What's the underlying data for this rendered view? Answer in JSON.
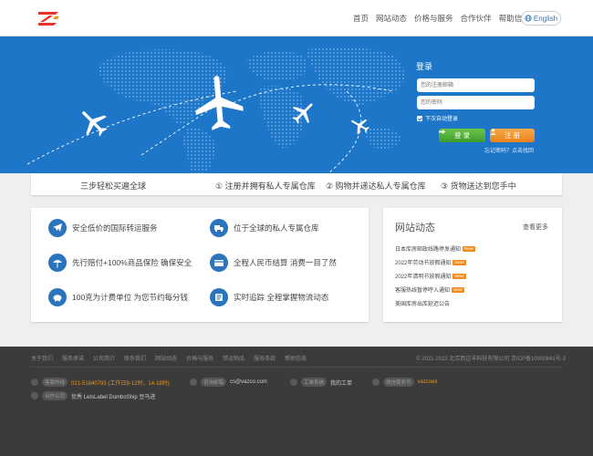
{
  "nav": {
    "items": [
      "首页",
      "网站动态",
      "价格与服务",
      "合作伙伴",
      "帮助信息"
    ],
    "lang_label": "English"
  },
  "login": {
    "title": "登录",
    "username_placeholder": "您的注册邮箱",
    "password_placeholder": "您的密码",
    "remember_label": "下次自动登录",
    "login_button": "登 录",
    "register_button": "注 册",
    "forgot_text": "忘记密码？点击找回"
  },
  "steps": {
    "title": "三步轻松买遍全球",
    "items": [
      "① 注册并拥有私人专属仓库",
      "② 购物并递达私人专属仓库",
      "③ 货物送达到您手中"
    ]
  },
  "features": [
    {
      "icon": "plane-icon",
      "text": "安全低价的国际转运服务"
    },
    {
      "icon": "truck-icon",
      "text": "位于全球的私人专属仓库"
    },
    {
      "icon": "umbrella-icon",
      "text": "先行赔付+100%商品保险 确保安全"
    },
    {
      "icon": "card-icon",
      "text": "全程人民币结算 消费一目了然"
    },
    {
      "icon": "piggy-bank-icon",
      "text": "100克为计费单位 为您节约每分钱"
    },
    {
      "icon": "list-icon",
      "text": "实时追踪 全程掌握物流动态"
    }
  ],
  "news": {
    "title": "网站动态",
    "more": "查看更多",
    "items": [
      {
        "text": "日本库房邮政线路停发通知",
        "is_new": true
      },
      {
        "text": "2022年劳动节放假通知",
        "is_new": true
      },
      {
        "text": "2022年清明节放假通知",
        "is_new": true
      },
      {
        "text": "客服热线暂停呼入通知",
        "is_new": true
      },
      {
        "text": "美国库房出库延迟公告",
        "is_new": false
      }
    ],
    "new_tag": "New!"
  },
  "footer": {
    "links": [
      "关于我们",
      "服务承诺",
      "公司简介",
      "联系我们",
      "网站动态",
      "价格与服务",
      "禁运物品",
      "服务条款",
      "帮助信息"
    ],
    "copyright": "© 2011-2022 北京西边羊科技有限公司 京ICP备10000841号-3",
    "phone_label": "客服热线",
    "phone_value": "021-51840793 (工作日9-12时，14-18时)",
    "email_label": "咨询邮箱",
    "email_value": "cs@vazco.com",
    "work_label": "工单系统",
    "work_value": "我的工单",
    "wechat_label": "微信服务号",
    "wechat_value": "vazcoex",
    "partner_label": "合作公司",
    "partners": "优秀  LetsLabel  DumboShip  豆马进"
  },
  "colors": {
    "hero_blue": "#1d76c7",
    "accent_blue": "#2a74bd",
    "login_green": "#4caf35",
    "register_orange": "#f0931f",
    "new_orange": "#f08a1c"
  }
}
